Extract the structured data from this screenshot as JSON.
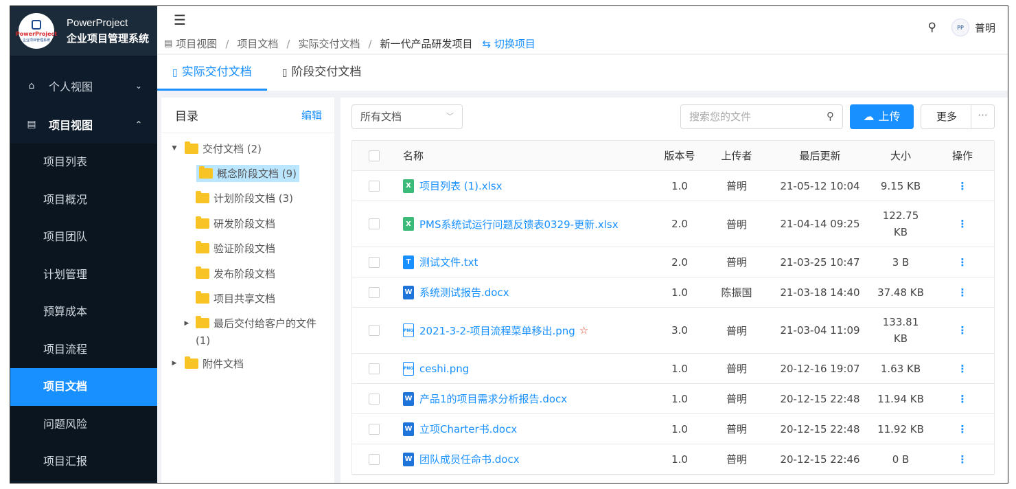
{
  "brand": {
    "logo_text": "PowerProject",
    "logo_sub": "企业项目管理系统",
    "line1": "PowerProject",
    "line2": "企业项目管理系统"
  },
  "sidebar": {
    "groups": [
      {
        "label": "个人视图",
        "icon": "home-icon",
        "expanded": false
      },
      {
        "label": "项目视图",
        "icon": "board-icon",
        "expanded": true
      }
    ],
    "items": [
      "项目列表",
      "项目概况",
      "项目团队",
      "计划管理",
      "预算成本",
      "项目流程",
      "项目文档",
      "问题风险",
      "项目汇报"
    ],
    "active_item": "项目文档"
  },
  "header": {
    "breadcrumb": [
      "项目视图",
      "项目文档",
      "实际交付文档",
      "新一代产品研发项目"
    ],
    "switch_label": "切换项目",
    "user_name": "普明",
    "avatar_text": "PP"
  },
  "tabs": [
    {
      "label": "实际交付文档",
      "active": true
    },
    {
      "label": "阶段交付文档",
      "active": false
    }
  ],
  "directory": {
    "title": "目录",
    "edit_label": "编辑",
    "tree": {
      "root1": "交付文档 (2)",
      "children": [
        "概念阶段文档 (9)",
        "计划阶段文档 (3)",
        "研发阶段文档",
        "验证阶段文档",
        "发布阶段文档",
        "项目共享文档"
      ],
      "last_child_line1": "最后交付给客户的文件",
      "last_child_line2": "(1)",
      "root2": "附件文档",
      "selected": "概念阶段文档 (9)"
    }
  },
  "toolbar": {
    "filter_value": "所有文档",
    "search_placeholder": "搜索您的文件",
    "upload_label": "上传",
    "more_label": "更多",
    "more_dots": "···"
  },
  "table": {
    "headers": {
      "name": "名称",
      "version": "版本号",
      "uploader": "上传者",
      "updated": "最后更新",
      "size": "大小",
      "ops": "操作"
    },
    "rows": [
      {
        "type": "xlsx",
        "name": "项目列表 (1).xlsx",
        "version": "1.0",
        "uploader": "普明",
        "updated": "21-05-12 10:04",
        "size": "9.15 KB",
        "size2": "",
        "starred": false
      },
      {
        "type": "xlsx",
        "name": "PMS系统试运行问题反馈表0329-更新.xlsx",
        "version": "2.0",
        "uploader": "普明",
        "updated": "21-04-14 09:25",
        "size": "122.75",
        "size2": "KB",
        "starred": false
      },
      {
        "type": "txt",
        "name": "测试文件.txt",
        "version": "2.0",
        "uploader": "普明",
        "updated": "21-03-25 10:47",
        "size": "3 B",
        "size2": "",
        "starred": false
      },
      {
        "type": "docx",
        "name": "系统测试报告.docx",
        "version": "1.0",
        "uploader": "陈振国",
        "updated": "21-03-18 14:40",
        "size": "37.48 KB",
        "size2": "",
        "starred": false
      },
      {
        "type": "png",
        "name": "2021-3-2-项目流程菜单移出.png",
        "version": "3.0",
        "uploader": "普明",
        "updated": "21-03-04 11:09",
        "size": "133.81",
        "size2": "KB",
        "starred": true
      },
      {
        "type": "png",
        "name": "ceshi.png",
        "version": "1.0",
        "uploader": "普明",
        "updated": "20-12-16 19:07",
        "size": "1.63 KB",
        "size2": "",
        "starred": false
      },
      {
        "type": "docx",
        "name": "产品1的项目需求分析报告.docx",
        "version": "1.0",
        "uploader": "普明",
        "updated": "20-12-15 22:48",
        "size": "11.94 KB",
        "size2": "",
        "starred": false
      },
      {
        "type": "docx",
        "name": "立项Charter书.docx",
        "version": "1.0",
        "uploader": "普明",
        "updated": "20-12-15 22:48",
        "size": "11.92 KB",
        "size2": "",
        "starred": false
      },
      {
        "type": "docx",
        "name": "团队成员任命书.docx",
        "version": "1.0",
        "uploader": "普明",
        "updated": "20-12-15 22:46",
        "size": "0 B",
        "size2": "",
        "starred": false
      }
    ],
    "op_glyph": "⋮"
  }
}
